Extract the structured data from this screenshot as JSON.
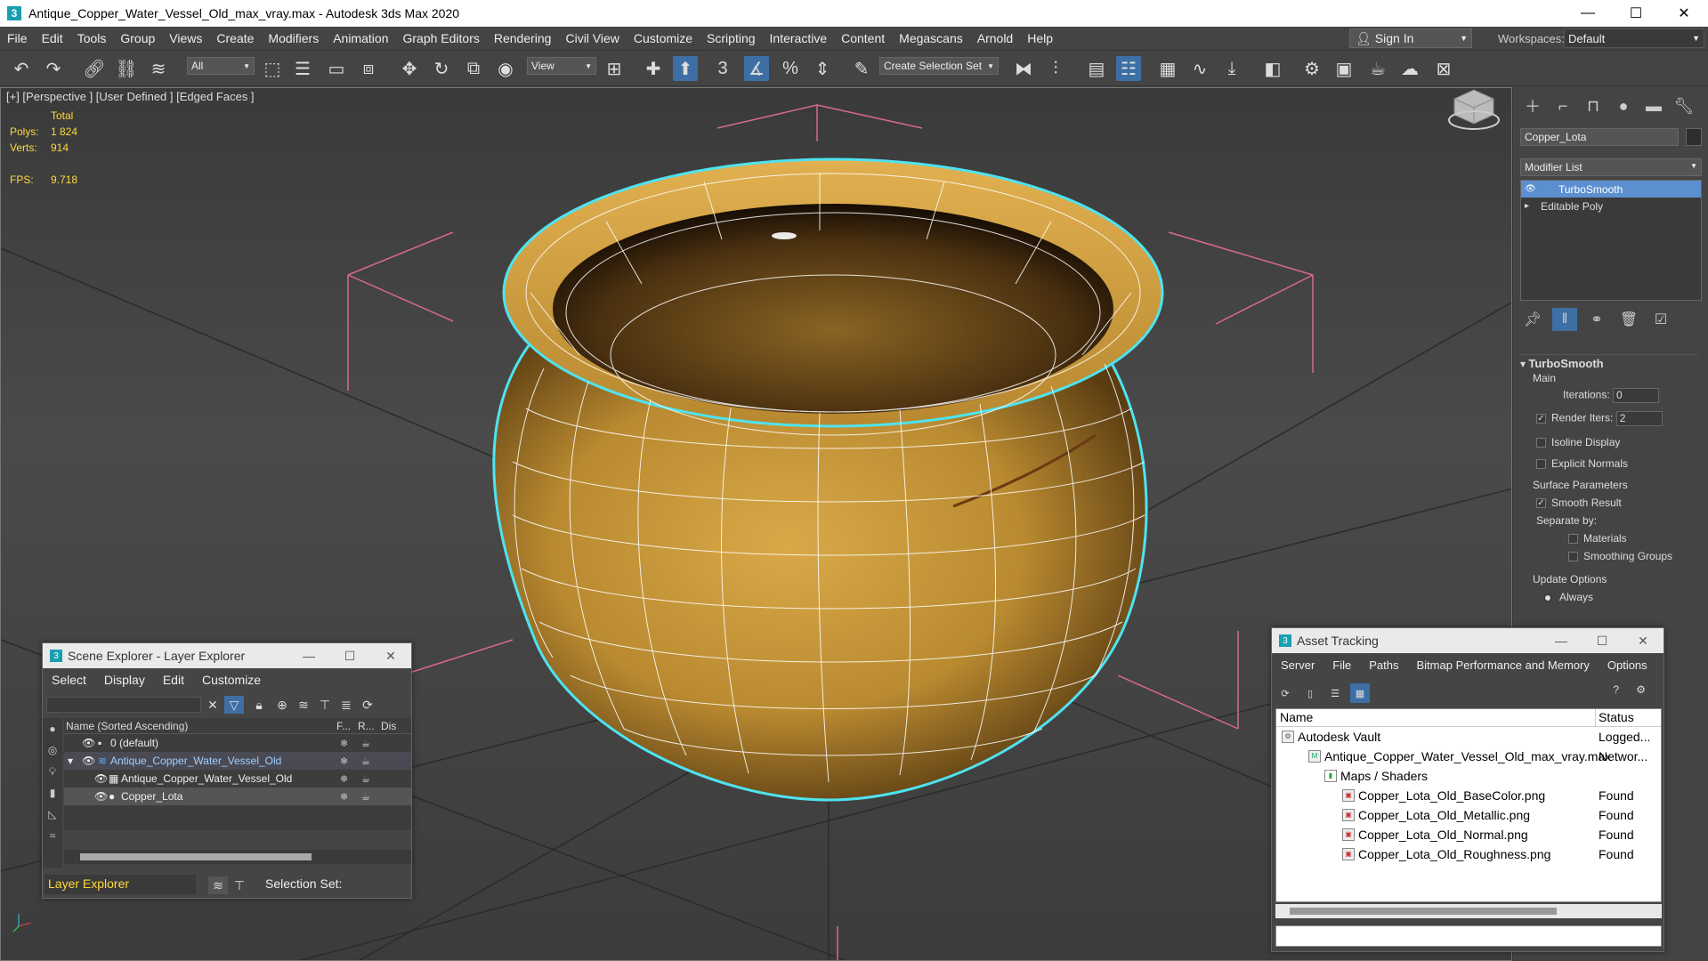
{
  "window": {
    "title": "Antique_Copper_Water_Vessel_Old_max_vray.max - Autodesk 3ds Max 2020",
    "app_icon": "3",
    "minimize": "—",
    "maximize": "☐",
    "close": "✕"
  },
  "menu": [
    "File",
    "Edit",
    "Tools",
    "Group",
    "Views",
    "Create",
    "Modifiers",
    "Animation",
    "Graph Editors",
    "Rendering",
    "Civil View",
    "Customize",
    "Scripting",
    "Interactive",
    "Content",
    "Megascans",
    "Arnold",
    "Help"
  ],
  "signin": "Sign In",
  "workspaces": {
    "label": "Workspaces:",
    "value": "Default"
  },
  "toolbar": {
    "filter": "All",
    "refcoord": "View",
    "selset": "Create Selection Set",
    "snap3": "3"
  },
  "viewport": {
    "label": "[+] [Perspective ] [User Defined ] [Edged Faces ]",
    "stats": {
      "total": "Total",
      "polys_label": "Polys:",
      "polys": "1 824",
      "verts_label": "Verts:",
      "verts": "914",
      "fps_label": "FPS:",
      "fps": "9.718"
    }
  },
  "command_panel": {
    "object_name": "Copper_Lota",
    "modifier_list": "Modifier List",
    "stack": [
      {
        "label": "TurboSmooth",
        "selected": true
      },
      {
        "label": "Editable Poly",
        "selected": false
      }
    ],
    "turbosmooth": {
      "title": "TurboSmooth",
      "main": "Main",
      "iterations_label": "Iterations:",
      "iterations": "0",
      "render_iters_label": "Render Iters:",
      "render_iters": "2",
      "isoline": "Isoline Display",
      "explicit_normals": "Explicit Normals",
      "surface_params": "Surface Parameters",
      "smooth_result": "Smooth Result",
      "separate_by": "Separate by:",
      "materials": "Materials",
      "smoothing_groups": "Smoothing Groups",
      "update_options": "Update Options",
      "always": "Always"
    }
  },
  "scene_explorer": {
    "title": "Scene Explorer - Layer Explorer",
    "menu": [
      "Select",
      "Display",
      "Edit",
      "Customize"
    ],
    "header": {
      "name": "Name (Sorted Ascending)",
      "c1": "F...",
      "c2": "R...",
      "c3": "Dis"
    },
    "rows": [
      {
        "name": "0 (default)"
      },
      {
        "name": "Antique_Copper_Water_Vessel_Old"
      },
      {
        "name": "Antique_Copper_Water_Vessel_Old"
      },
      {
        "name": "Copper_Lota"
      }
    ],
    "footer_layer": "Layer Explorer",
    "selection_set": "Selection Set:"
  },
  "asset_tracking": {
    "title": "Asset Tracking",
    "menu": [
      "Server",
      "File",
      "Paths",
      "Bitmap Performance and Memory",
      "Options"
    ],
    "columns": {
      "name": "Name",
      "status": "Status"
    },
    "rows": [
      {
        "name": "Autodesk Vault",
        "status": "Logged..."
      },
      {
        "name": "Antique_Copper_Water_Vessel_Old_max_vray.max",
        "status": "Networ..."
      },
      {
        "name": "Maps / Shaders",
        "status": ""
      },
      {
        "name": "Copper_Lota_Old_BaseColor.png",
        "status": "Found"
      },
      {
        "name": "Copper_Lota_Old_Metallic.png",
        "status": "Found"
      },
      {
        "name": "Copper_Lota_Old_Normal.png",
        "status": "Found"
      },
      {
        "name": "Copper_Lota_Old_Roughness.png",
        "status": "Found"
      }
    ]
  },
  "colors": {
    "accent_blue": "#5b8fd0",
    "stats_yellow": "#ffd93a",
    "selection_cyan": "#4fe3f0",
    "gizmo_pink": "#d86a8a",
    "vessel_gold": "#c8973a"
  }
}
